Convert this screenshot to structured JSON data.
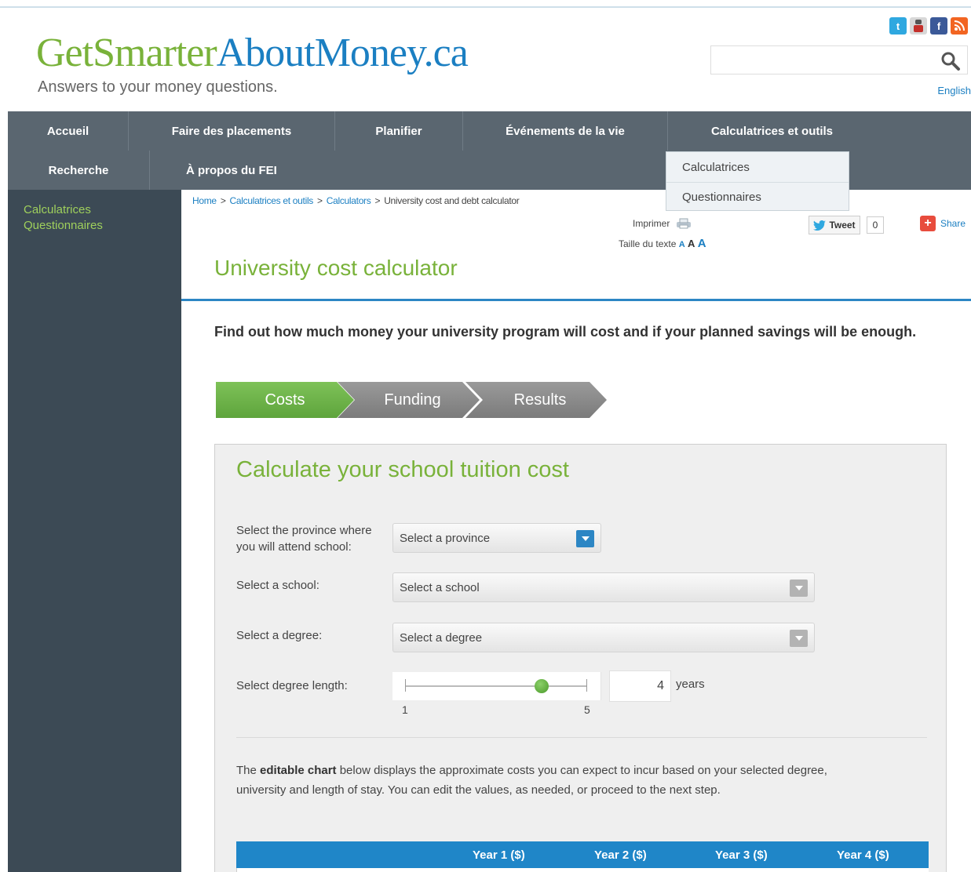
{
  "site": {
    "logo_part1": "GetSmarter",
    "logo_part2": "AboutMoney.ca",
    "tagline": "Answers to your money questions.",
    "lang_link": "English",
    "search": {
      "placeholder": ""
    }
  },
  "social_icons": [
    "twitter-icon",
    "youtube-icon",
    "facebook-icon",
    "rss-icon"
  ],
  "nav": {
    "row1": [
      "Accueil",
      "Faire des placements",
      "Planifier",
      "Événements de la vie",
      "Calculatrices et outils"
    ],
    "row2": [
      "Recherche",
      "À propos du FEI"
    ],
    "dropdown": [
      "Calculatrices",
      "Questionnaires"
    ]
  },
  "sidebar": {
    "items": [
      "Calculatrices",
      "Questionnaires"
    ]
  },
  "breadcrumb": [
    "Home",
    "Calculatrices et outils",
    "Calculators",
    "University cost and debt calculator"
  ],
  "tools": {
    "print_label": "Imprimer",
    "text_size_label": "Taille du texte",
    "text_size_options": [
      "A",
      "A",
      "A"
    ],
    "tweet_label": "Tweet",
    "tweet_count": "0",
    "share_label": "Share"
  },
  "page": {
    "title": "University cost calculator",
    "intro": "Find out how much money your university program will cost and if your planned savings will be enough."
  },
  "steps": [
    "Costs",
    "Funding",
    "Results"
  ],
  "calculator": {
    "title": "Calculate your school tuition cost",
    "province_label": "Select the province where you will attend school:",
    "province_value": "Select a province",
    "school_label": "Select a school:",
    "school_value": "Select a school",
    "degree_label": "Select a degree:",
    "degree_value": "Select a degree",
    "length_label": "Select degree length:",
    "length_min": "1",
    "length_max": "5",
    "length_value": "4",
    "length_unit": "years",
    "desc_bold": "editable chart",
    "desc_pre": "The ",
    "desc_post": " below displays the approximate costs you can expect to incur based on your selected degree, university and length of stay. You can edit the values, as needed, or proceed to the next step."
  },
  "table": {
    "headers": [
      "",
      "Year 1 ($)",
      "Year 2 ($)",
      "Year 3 ($)",
      "Year 4 ($)"
    ]
  },
  "colors": {
    "brand_green": "#79b23a",
    "brand_blue": "#1b7fc2",
    "nav_bg": "#5a6670",
    "sidebar_bg": "#3c4a55",
    "table_header": "#1f86c8"
  }
}
